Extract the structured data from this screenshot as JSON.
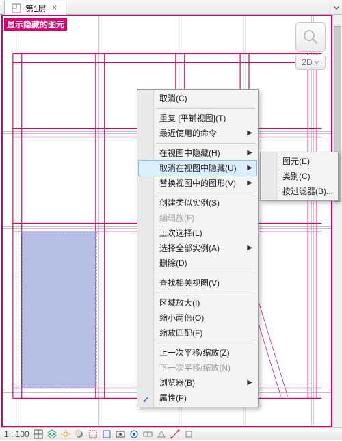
{
  "tab": {
    "title": "第1层",
    "close": "×"
  },
  "hint": "显示隐藏的图元",
  "viewcube": {
    "mode": "2D"
  },
  "status": {
    "scale_label": "1 : 100"
  },
  "context_menu": {
    "items": [
      {
        "label": "取消(C)"
      },
      {
        "sep": true
      },
      {
        "label": "重复 [平铺视图](T)"
      },
      {
        "label": "最近使用的命令",
        "submenu": true
      },
      {
        "sep": true
      },
      {
        "label": "在视图中隐藏(H)",
        "submenu": true
      },
      {
        "label": "取消在视图中隐藏(U)",
        "submenu": true,
        "hover": true
      },
      {
        "label": "替换视图中的图形(V)",
        "submenu": true
      },
      {
        "sep": true
      },
      {
        "label": "创建类似实例(S)"
      },
      {
        "label": "编辑族(F)",
        "disabled": true
      },
      {
        "label": "上次选择(L)"
      },
      {
        "label": "选择全部实例(A)",
        "submenu": true
      },
      {
        "label": "删除(D)"
      },
      {
        "sep": true
      },
      {
        "label": "查找相关视图(V)"
      },
      {
        "sep": true
      },
      {
        "label": "区域放大(I)"
      },
      {
        "label": "缩小两倍(O)"
      },
      {
        "label": "缩放匹配(F)"
      },
      {
        "sep": true
      },
      {
        "label": "上一次平移/缩放(Z)"
      },
      {
        "label": "下一次平移/缩放(N)",
        "disabled": true
      },
      {
        "label": "浏览器(B)",
        "submenu": true
      },
      {
        "label": "属性(P)",
        "checked": true
      }
    ]
  },
  "submenu": {
    "items": [
      {
        "label": "图元(E)"
      },
      {
        "label": "类别(C)"
      },
      {
        "label": "按过滤器(B)..."
      }
    ]
  }
}
